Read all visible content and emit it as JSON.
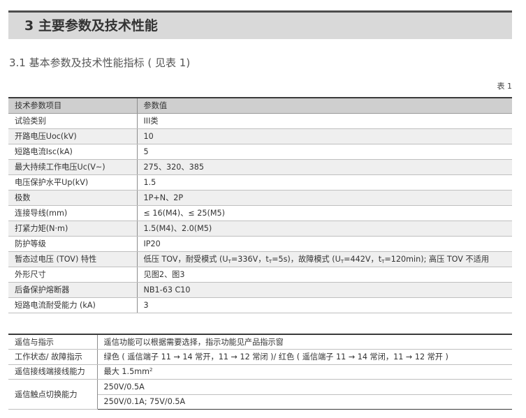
{
  "section": {
    "title": "3 主要参数及技术性能"
  },
  "subsection": {
    "title": "3.1 基本参数及技术性能指标 ( 见表 1)"
  },
  "table1": {
    "tag": "表 1",
    "header": [
      "技术参数项目",
      "参数值"
    ],
    "rows": [
      [
        "试验类别",
        "III类"
      ],
      [
        "开路电压Uoc(kV)",
        "10"
      ],
      [
        "短路电流Isc(kA)",
        "5"
      ],
      [
        "最大持续工作电压Uc(V~)",
        "275、320、385"
      ],
      [
        "电压保护水平Up(kV)",
        "1.5"
      ],
      [
        "极数",
        "1P+N、2P"
      ],
      [
        "连接导线(mm)",
        "≤ 16(M4)、≤ 25(M5)"
      ],
      [
        "打紧力矩(N·m)",
        "1.5(M4)、2.0(M5)"
      ],
      [
        "防护等级",
        "IP20"
      ],
      [
        "暂态过电压 (TOV) 特性",
        ""
      ],
      [
        "外形尺寸",
        "见图2、图3"
      ],
      [
        "后备保护熔断器",
        "NB1-63 C10"
      ],
      [
        "短路电流耐受能力 (kA)",
        "3"
      ]
    ],
    "tov": {
      "p1": "低压 TOV，耐受模式 (U",
      "sub1": "T",
      "p2": "=336V，t",
      "sub2": "T",
      "p3": "=5s)，故障模式 (U",
      "sub3": "T",
      "p4": "=442V，t",
      "sub4": "T",
      "p5": "=120min); 高压 TOV 不适用"
    }
  },
  "table2": {
    "rows": [
      [
        "遥信与指示",
        "遥信功能可以根据需要选择，指示功能见产品指示窗"
      ],
      [
        "工作状态/ 故障指示",
        "绿色 ( 遥信端子 11 → 14 常开，11 → 12 常闭 )/ 红色 ( 遥信端子 11 → 14 常闭，11 → 12 常开 )"
      ],
      [
        "遥信接线端接线能力",
        "最大 1.5mm"
      ]
    ],
    "wire_sup": "2",
    "contact": {
      "label": "遥信触点切换能力",
      "values": [
        "250V/0.5A",
        "250V/0.1A; 75V/0.5A"
      ]
    }
  }
}
